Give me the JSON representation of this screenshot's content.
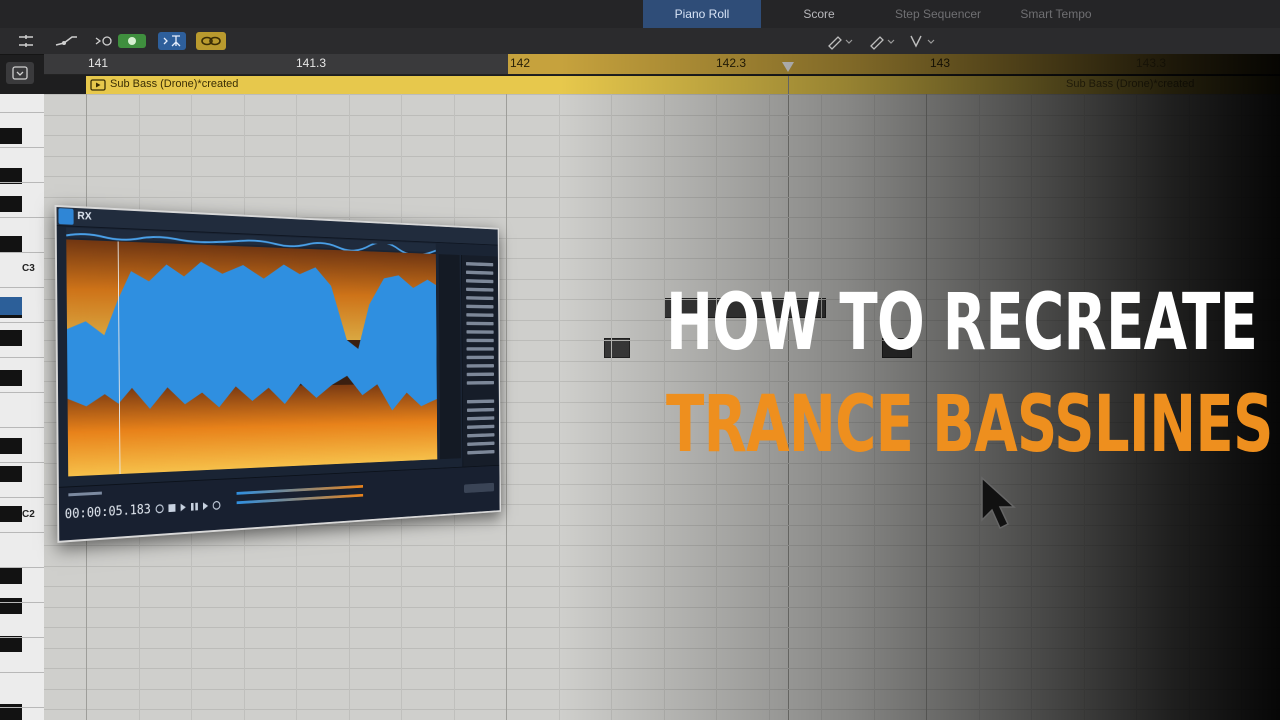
{
  "tabs": [
    {
      "label": "Piano Roll",
      "active": true
    },
    {
      "label": "Score",
      "active": false
    },
    {
      "label": "Step Sequencer",
      "active": false
    },
    {
      "label": "Smart Tempo",
      "active": false
    }
  ],
  "ruler": {
    "bars": [
      "141",
      "141.3",
      "142",
      "142.3",
      "143",
      "143.3"
    ]
  },
  "region": {
    "name": "Sub Bass (Drone)*created",
    "name_repeat": "Sub Bass (Drone)*created"
  },
  "keyboard": {
    "labels": [
      "C3",
      "C2"
    ]
  },
  "headline": {
    "line1": "HOW TO RECREATE",
    "line2": "TRANCE BASSLINES"
  },
  "rx": {
    "app_name": "RX",
    "time": "00:00:05.183"
  },
  "colors": {
    "selection_gold": "#c6a23d",
    "region_yellow": "#e7c84c",
    "headline_orange": "#ee8f1e",
    "tab_active": "#2f4d78",
    "spectrogram_blue": "#2f8fe0",
    "spectrogram_orange": "#e8821a"
  }
}
